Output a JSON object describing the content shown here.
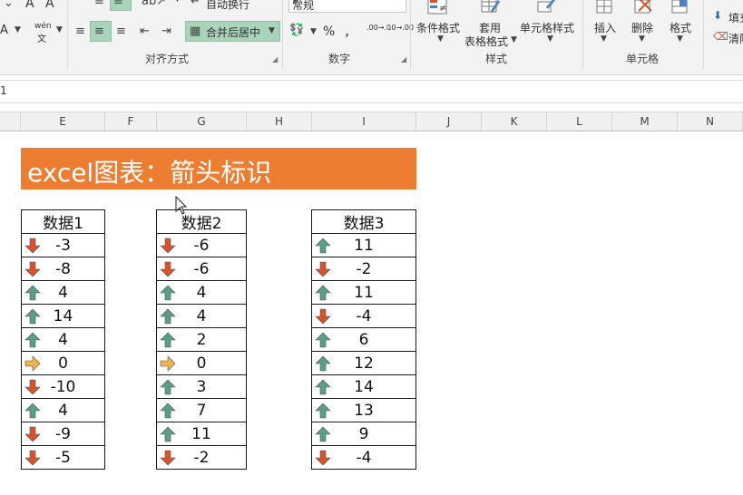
{
  "ribbon": {
    "wrap_text_label": "自动换行",
    "merge_center_label": "合并后居中",
    "number_format_value": "常规",
    "percent_symbol": "%",
    "comma_symbol": ",",
    "increase_decimal_label": ".00→.0",
    "decrease_decimal_label": ".0→.00",
    "cond_format_label": "条件格式",
    "table_format_label_1": "套用",
    "table_format_label_2": "表格格式",
    "cell_style_label": "单元格样式",
    "insert_label": "插入",
    "delete_label": "删除",
    "format_label": "格式",
    "fill_label": "填充",
    "clear_label": "清除",
    "font_a_label": "A",
    "phonetic_label": "wén",
    "group_alignment": "对齐方式",
    "group_number": "数字",
    "group_styles": "样式",
    "group_cells": "单元格"
  },
  "formula_bar": {
    "row_ref": "1"
  },
  "columns": [
    "E",
    "F",
    "G",
    "H",
    "I",
    "J",
    "K",
    "L",
    "M",
    "N"
  ],
  "sheet": {
    "title": "excel图表：箭头标识",
    "tables": [
      {
        "header": "数据1",
        "rows": [
          {
            "value": "-3",
            "icon": "down-arrow-icon"
          },
          {
            "value": "-8",
            "icon": "down-arrow-icon"
          },
          {
            "value": "4",
            "icon": "up-arrow-icon"
          },
          {
            "value": "14",
            "icon": "up-arrow-icon"
          },
          {
            "value": "4",
            "icon": "up-arrow-icon"
          },
          {
            "value": "0",
            "icon": "right-arrow-icon"
          },
          {
            "value": "-10",
            "icon": "down-arrow-icon"
          },
          {
            "value": "4",
            "icon": "up-arrow-icon"
          },
          {
            "value": "-9",
            "icon": "down-arrow-icon"
          },
          {
            "value": "-5",
            "icon": "down-arrow-icon"
          }
        ]
      },
      {
        "header": "数据2",
        "rows": [
          {
            "value": "-6",
            "icon": "down-arrow-icon"
          },
          {
            "value": "-6",
            "icon": "down-arrow-icon"
          },
          {
            "value": "4",
            "icon": "up-arrow-icon"
          },
          {
            "value": "4",
            "icon": "up-arrow-icon"
          },
          {
            "value": "2",
            "icon": "up-arrow-icon"
          },
          {
            "value": "0",
            "icon": "right-arrow-icon"
          },
          {
            "value": "3",
            "icon": "up-arrow-icon"
          },
          {
            "value": "7",
            "icon": "up-arrow-icon"
          },
          {
            "value": "11",
            "icon": "up-arrow-icon"
          },
          {
            "value": "-2",
            "icon": "down-arrow-icon"
          }
        ]
      },
      {
        "header": "数据3",
        "rows": [
          {
            "value": "11",
            "icon": "up-arrow-icon"
          },
          {
            "value": "-2",
            "icon": "down-arrow-icon"
          },
          {
            "value": "11",
            "icon": "up-arrow-icon"
          },
          {
            "value": "-4",
            "icon": "down-arrow-icon"
          },
          {
            "value": "6",
            "icon": "up-arrow-icon"
          },
          {
            "value": "12",
            "icon": "up-arrow-icon"
          },
          {
            "value": "14",
            "icon": "up-arrow-icon"
          },
          {
            "value": "13",
            "icon": "up-arrow-icon"
          },
          {
            "value": "9",
            "icon": "up-arrow-icon"
          },
          {
            "value": "-4",
            "icon": "down-arrow-icon"
          }
        ]
      }
    ]
  },
  "colors": {
    "title_bg": "#ed7d31",
    "up": "#5a9e86",
    "down": "#d9522a",
    "flat": "#f0b24a",
    "active_button": "#a8d4b9"
  }
}
